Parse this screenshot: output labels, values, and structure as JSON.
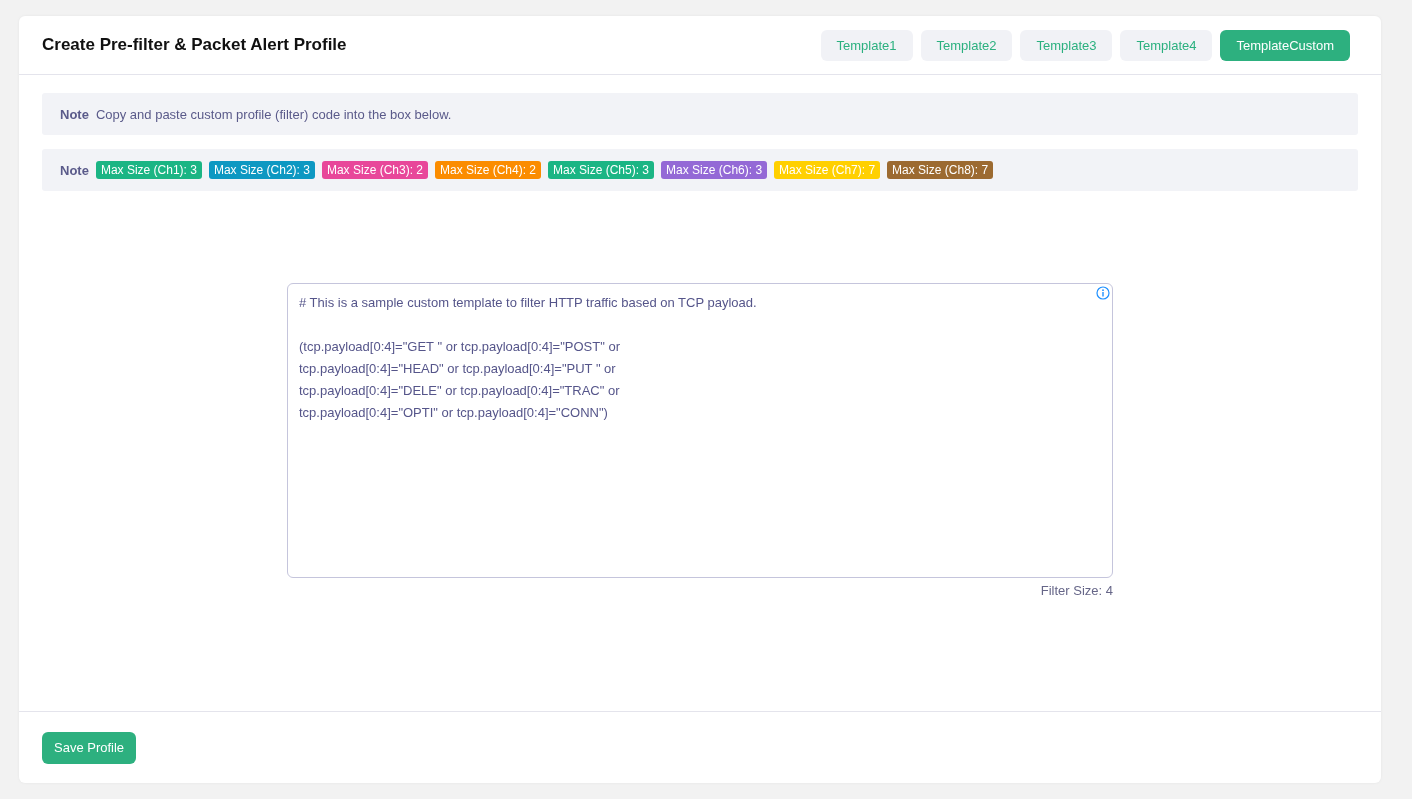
{
  "title": "Create Pre-filter & Packet Alert Profile",
  "templates": [
    {
      "label": "Template1",
      "selected": false
    },
    {
      "label": "Template2",
      "selected": false
    },
    {
      "label": "Template3",
      "selected": false
    },
    {
      "label": "Template4",
      "selected": false
    },
    {
      "label": "TemplateCustom",
      "selected": true
    }
  ],
  "note_1": {
    "label": "Note",
    "text": "Copy and paste custom profile (filter) code into the box below."
  },
  "note_2": {
    "label": "Note",
    "badges": [
      {
        "text": "Max Size (Ch1): 3",
        "color": "#1bb584"
      },
      {
        "text": "Max Size (Ch2): 3",
        "color": "#0d98c2"
      },
      {
        "text": "Max Size (Ch3): 2",
        "color": "#e8479a"
      },
      {
        "text": "Max Size (Ch4): 2",
        "color": "#fb8c00"
      },
      {
        "text": "Max Size (Ch5): 3",
        "color": "#1bb584"
      },
      {
        "text": "Max Size (Ch6): 3",
        "color": "#9469d6"
      },
      {
        "text": "Max Size (Ch7): 7",
        "color": "#ffd000"
      },
      {
        "text": "Max Size (Ch8): 7",
        "color": "#9c6a31"
      }
    ]
  },
  "code_box": {
    "comment": "# This is a sample custom template to filter HTTP traffic based on TCP payload.",
    "code_lines": [
      "(tcp.payload[0:4]=\"GET \" or tcp.payload[0:4]=\"POST\" or",
      "tcp.payload[0:4]=\"HEAD\" or tcp.payload[0:4]=\"PUT \" or",
      "tcp.payload[0:4]=\"DELE\" or tcp.payload[0:4]=\"TRAC\" or",
      "tcp.payload[0:4]=\"OPTI\" or tcp.payload[0:4]=\"CONN\")"
    ]
  },
  "filter_size": "Filter Size: 4",
  "save_button": "Save Profile"
}
